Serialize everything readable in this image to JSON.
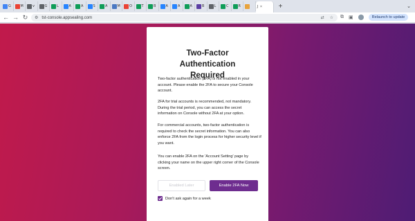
{
  "browser": {
    "tabs": [
      {
        "icon": "google-icon",
        "color": "#4285f4",
        "text": "G"
      },
      {
        "icon": "gmail-icon",
        "color": "#ea4335",
        "text": "M"
      },
      {
        "icon": "page-icon",
        "color": "#5f6368",
        "text": "v"
      },
      {
        "icon": "globe-icon",
        "color": "#5f6368",
        "text": "G"
      },
      {
        "icon": "sheets-icon",
        "color": "#0f9d58",
        "text": "L"
      },
      {
        "icon": "jira-icon",
        "color": "#2684ff",
        "text": "A"
      },
      {
        "icon": "sheets-icon",
        "color": "#0f9d58",
        "text": "A"
      },
      {
        "icon": "jira-icon",
        "color": "#2684ff",
        "text": "S"
      },
      {
        "icon": "sheets-icon",
        "color": "#0f9d58",
        "text": "A"
      },
      {
        "icon": "docs-icon",
        "color": "#4a78c2",
        "text": "M"
      },
      {
        "icon": "gmail-icon",
        "color": "#ea4335",
        "text": "O"
      },
      {
        "icon": "sheets-icon",
        "color": "#0f9d58",
        "text": "T"
      },
      {
        "icon": "sheets-icon",
        "color": "#0f9d58",
        "text": "B"
      },
      {
        "icon": "jira-icon",
        "color": "#2684ff",
        "text": "A"
      },
      {
        "icon": "jira-icon",
        "color": "#2684ff",
        "text": "A"
      },
      {
        "icon": "sheets-icon",
        "color": "#0f9d58",
        "text": "A"
      },
      {
        "icon": "vscode-icon",
        "color": "#5b3fa3",
        "text": "B"
      },
      {
        "icon": "globe-icon",
        "color": "#5f6368",
        "text": "L"
      },
      {
        "icon": "sheets-icon",
        "color": "#0f9d58",
        "text": "C"
      },
      {
        "icon": "sheets-icon",
        "color": "#0f9d58",
        "text": "R"
      },
      {
        "icon": "shield-icon",
        "color": "#e8a33c",
        "text": ""
      }
    ],
    "active_tab": {
      "text": "J",
      "close": "×"
    },
    "new_tab": "+",
    "url": "tst-console.appsealing.com",
    "relaunch_label": "Relaunch to update"
  },
  "dialog": {
    "title": "Two-Factor Authentication Required",
    "paragraphs": [
      "Two-factor authentication (2FA) is not enabled in your account. Please enable the 2FA to secure your Console account.",
      "2FA for trial accounts is recommended, not mandatory. During the trial period, you can access the secret information on Console without 2FA at your option.",
      "For commercial accounts, two-factor authentication is required to check the secret information. You can also enforce 2FA from the login process for higher security level if you want.",
      "You can enable 2FA on the 'Account Setting' page by clicking your name on the upper right corner of the Console screen."
    ],
    "later_button": "Enabled Later",
    "enable_button": "Enable 2FA Now",
    "checkbox_label": "Don't ask again for a week",
    "checkbox_checked": true
  },
  "colors": {
    "accent": "#6e2d8f",
    "gradient_start": "#c11a4b",
    "gradient_end": "#4e1c74"
  }
}
